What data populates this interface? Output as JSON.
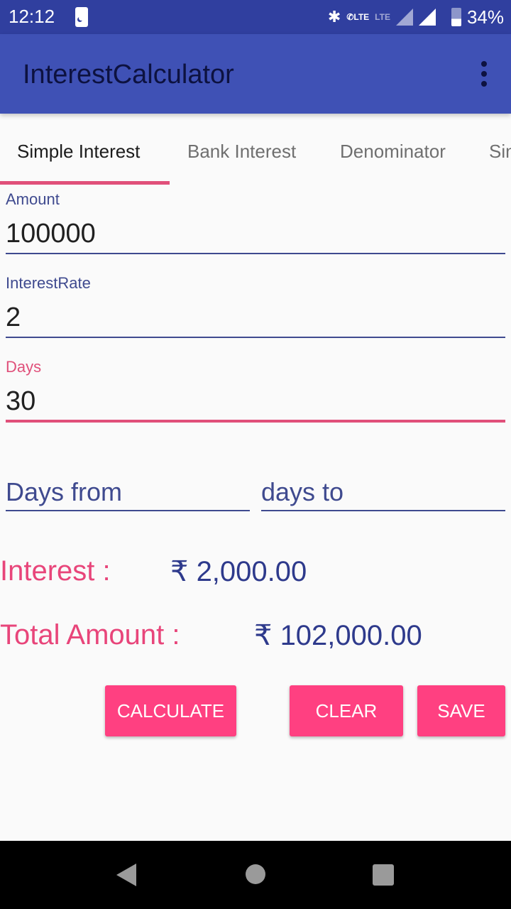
{
  "status_bar": {
    "time": "12:12",
    "lte_label": "LTE",
    "lte2_label": "LTE",
    "battery_percent": "34%",
    "icons": [
      "do-not-disturb-icon",
      "bluetooth-icon",
      "wifi-calling-icon",
      "lte-icon",
      "signal-icon",
      "signal-icon",
      "battery-charging-icon"
    ]
  },
  "app_bar": {
    "title": "InterestCalculator",
    "menu_icon": "more-vert-icon"
  },
  "tabs": [
    {
      "label": "Simple Interest",
      "active": true
    },
    {
      "label": "Bank Interest",
      "active": false
    },
    {
      "label": "Denominator",
      "active": false
    },
    {
      "label": "Sim",
      "active": false
    }
  ],
  "form": {
    "amount": {
      "label": "Amount",
      "value": "100000"
    },
    "interest_rate": {
      "label": "InterestRate",
      "value": "2"
    },
    "days": {
      "label": "Days",
      "value": "30"
    },
    "days_from": {
      "placeholder": "Days from",
      "value": ""
    },
    "days_to": {
      "placeholder": "days to",
      "value": ""
    }
  },
  "results": {
    "interest_label": "Interest :",
    "interest_value": "₹ 2,000.00",
    "total_label": "Total Amount :",
    "total_value": "₹ 102,000.00"
  },
  "buttons": {
    "calculate": "CALCULATE",
    "clear": "CLEAR",
    "save": "SAVE"
  },
  "colors": {
    "primary": "#3f51b5",
    "primary_dark": "#303f9f",
    "accent": "#ff4081"
  }
}
